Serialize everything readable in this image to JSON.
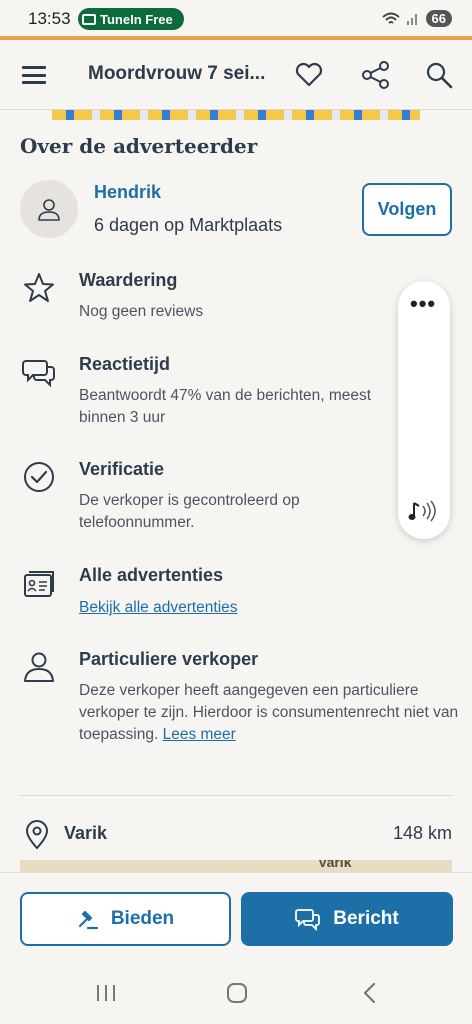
{
  "status_bar": {
    "time": "13:53",
    "notification_pill": "TuneIn Free",
    "battery": "66"
  },
  "header": {
    "title": "Moordvrouw 7 sei..."
  },
  "about": {
    "section_title": "Over de adverteerder",
    "seller_name": "Hendrik",
    "seller_since": "6 dagen op Marktplaats",
    "follow_label": "Volgen"
  },
  "details": [
    {
      "title": "Waardering",
      "text": "Nog geen reviews"
    },
    {
      "title": "Reactietijd",
      "text": "Beantwoordt 47% van de berichten, meest binnen 3 uur"
    },
    {
      "title": "Verificatie",
      "text": "De verkoper is gecontroleerd op telefoonnummer."
    },
    {
      "title": "Alle advertenties",
      "link": "Bekijk alle advertenties"
    },
    {
      "title": "Particuliere verkoper",
      "text": "Deze verkoper heeft aangegeven een particuliere verkoper te zijn. Hierdoor is consumentenrecht niet van toepassing. ",
      "link": "Lees meer"
    }
  ],
  "floating_panel": {
    "menu": "•••"
  },
  "location": {
    "name": "Varik",
    "distance": "148 km",
    "map_label": "Varik"
  },
  "actions": {
    "bid_label": "Bieden",
    "message_label": "Bericht"
  },
  "colors": {
    "accent": "#1d6fa8",
    "text": "#2d3c4d",
    "background": "#f7f5f2",
    "orange_line": "#e8a24f"
  },
  "icons": [
    "menu-icon",
    "heart-icon",
    "share-icon",
    "search-icon",
    "user-icon",
    "star-icon",
    "chat-icon",
    "check-circle-icon",
    "ads-icon",
    "person-icon",
    "location-pin-icon",
    "gavel-icon",
    "message-icon",
    "audio-icon"
  ]
}
